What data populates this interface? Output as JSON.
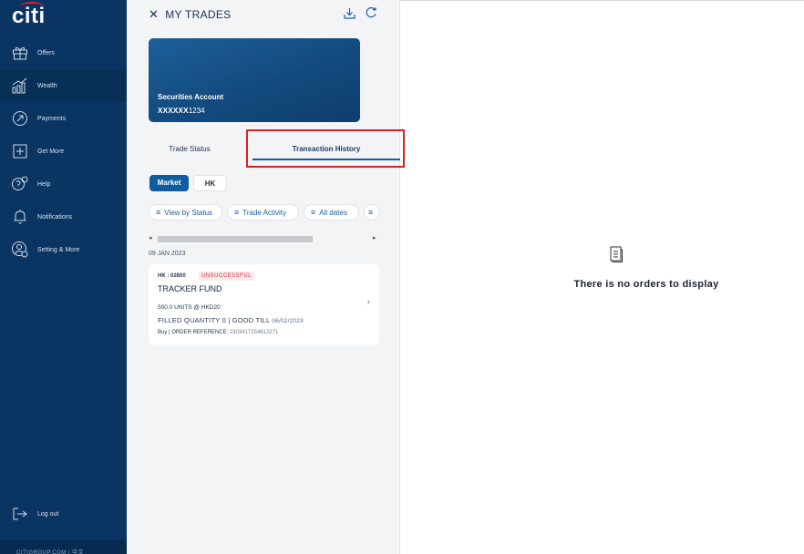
{
  "sidebar": {
    "logo": "citi",
    "items": [
      {
        "label": "Offers",
        "icon": "gift-icon"
      },
      {
        "label": "Wealth",
        "icon": "growth-chart-icon"
      },
      {
        "label": "Payments",
        "icon": "payments-icon"
      },
      {
        "label": "Get More",
        "icon": "plus-box-icon"
      },
      {
        "label": "Help",
        "icon": "help-bubble-icon"
      },
      {
        "label": "Notifications",
        "icon": "bell-icon"
      },
      {
        "label": "Setting & More",
        "icon": "settings-user-icon"
      }
    ],
    "logout": {
      "label": "Log out",
      "icon": "logout-icon"
    },
    "footer": "CITIGROUP.COM  |  中文"
  },
  "header": {
    "close_icon": "close-icon",
    "title": "MY TRADES",
    "download_icon": "download-icon",
    "refresh_icon": "refresh-icon"
  },
  "account_card": {
    "label": "Securities Account",
    "masked": "XXXXXX",
    "suffix": "1234"
  },
  "tabs": {
    "status": "Trade Status",
    "history": "Transaction History"
  },
  "segments": {
    "market": "Market",
    "hk": "HK"
  },
  "filters": {
    "status": "View by Status",
    "activity": "Trade Activity",
    "dates": "All dates"
  },
  "orders": {
    "date": "09 JAN 2023",
    "item": {
      "symbol": "HK : 02800",
      "status": "UNSUCCESSFUL",
      "name": "TRACKER FUND",
      "units_price": "500.0 UNITS @ HKD20",
      "filled": "FILLED QUANTITY 0 | GOOD TILL ",
      "good_till": "06/02/2023",
      "side_ref": "Buy | ORDER REFERENCE: ",
      "reference": "2303417254812271"
    }
  },
  "empty_state": {
    "icon": "document-icon",
    "message": "There is no orders to display"
  },
  "colors": {
    "sidebar": "#0a3461",
    "accent": "#0f5d9e",
    "highlight": "#e02020",
    "status_error": "#c8333f"
  }
}
